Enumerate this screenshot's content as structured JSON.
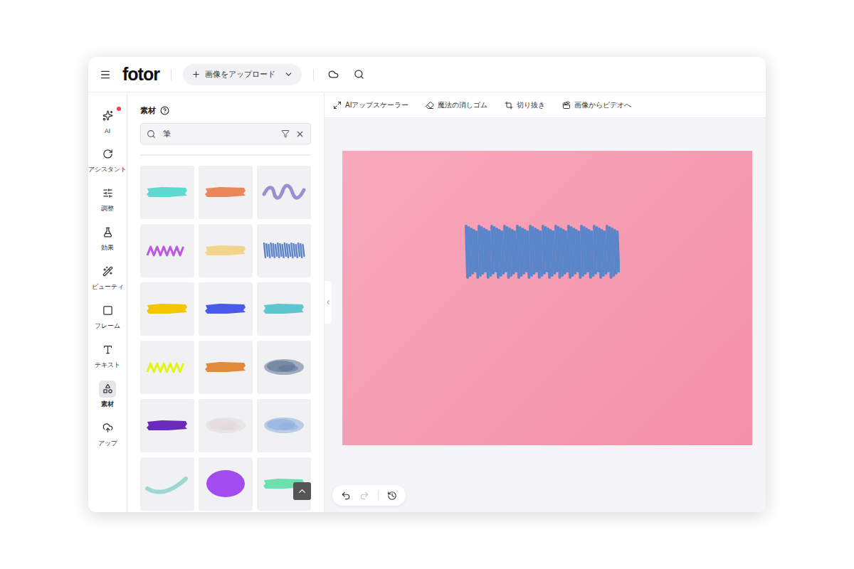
{
  "header": {
    "logo": "fotor",
    "upload_button": "画像をアップロード"
  },
  "rail": [
    {
      "label": "AI",
      "selected": false,
      "badge": true
    },
    {
      "label": "アシスタント",
      "selected": false,
      "badge": false
    },
    {
      "label": "調整",
      "selected": false,
      "badge": false
    },
    {
      "label": "効果",
      "selected": false,
      "badge": false
    },
    {
      "label": "ビューティ",
      "selected": false,
      "badge": false
    },
    {
      "label": "フレーム",
      "selected": false,
      "badge": false
    },
    {
      "label": "テキスト",
      "selected": false,
      "badge": false
    },
    {
      "label": "素材",
      "selected": true,
      "badge": false
    },
    {
      "label": "アップ",
      "selected": false,
      "badge": false
    }
  ],
  "panel": {
    "title": "素材",
    "search_value": "筆"
  },
  "brushes": [
    {
      "kind": "stroke",
      "color": "#5fd8d0"
    },
    {
      "kind": "stroke",
      "color": "#e8875a"
    },
    {
      "kind": "wave",
      "color": "#9a8fd0"
    },
    {
      "kind": "zigzag",
      "color": "#c056e6"
    },
    {
      "kind": "stroke",
      "color": "#f2d58a"
    },
    {
      "kind": "scribble",
      "color": "#5b82c8"
    },
    {
      "kind": "stroke",
      "color": "#f2c700"
    },
    {
      "kind": "stroke",
      "color": "#4a5ae8"
    },
    {
      "kind": "stroke",
      "color": "#5fc6cf"
    },
    {
      "kind": "zigzag",
      "color": "#e4f514"
    },
    {
      "kind": "stroke",
      "color": "#e08a3a"
    },
    {
      "kind": "smudge",
      "color": "#5c7393"
    },
    {
      "kind": "stroke",
      "color": "#6a2bb8"
    },
    {
      "kind": "smudge",
      "color": "#e2d8d8"
    },
    {
      "kind": "smudge",
      "color": "#8aaee0"
    },
    {
      "kind": "curve",
      "color": "#9dd8d0"
    },
    {
      "kind": "blob",
      "color": "#a24cf0"
    },
    {
      "kind": "stroke",
      "color": "#6ee0b0"
    }
  ],
  "toolbar": [
    "AIアップスケーラー",
    "魔法の消しゴム",
    "切り抜き",
    "画像からビデオへ"
  ],
  "canvas": {
    "sticker": {
      "kind": "scribble",
      "color": "#5a86c9"
    }
  },
  "history": {
    "undo_disabled": false,
    "redo_disabled": true
  }
}
